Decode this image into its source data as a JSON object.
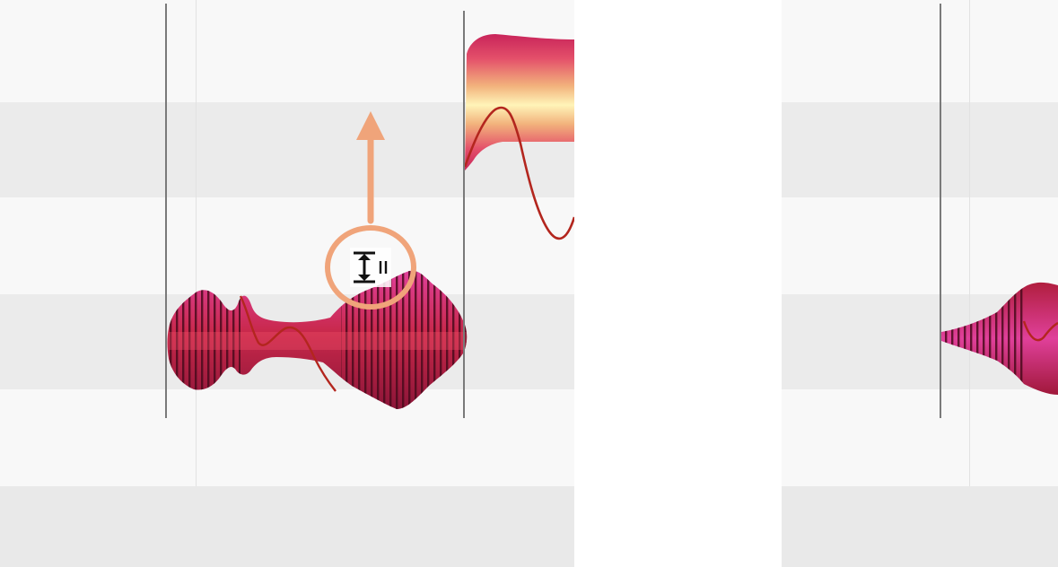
{
  "colors": {
    "blob_dark": "#8c1538",
    "blob_mid": "#c82a4c",
    "blob_hot": "#e0409a",
    "blob_light": "#f5e79a",
    "pitch_curve": "#b3261e",
    "arrow": "#f0a47a",
    "grid_light": "#f8f8f8",
    "grid_dark": "#ebebeb",
    "separator": "#7a7a7a"
  },
  "icons": {
    "pitch_tool": "amplitude-tool-icon",
    "arrow": "up-arrow-icon",
    "highlight": "highlight-circle-icon"
  }
}
